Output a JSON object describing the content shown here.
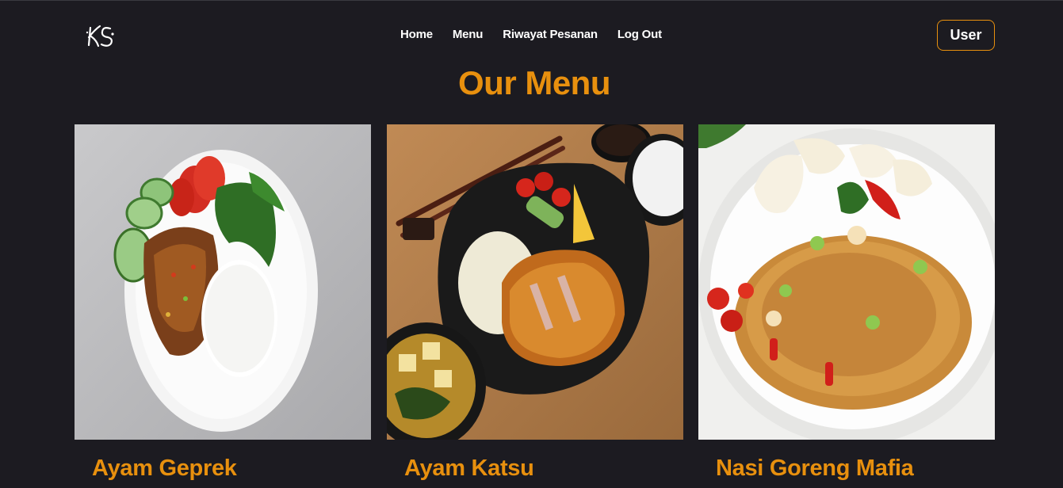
{
  "brand": {
    "logo_text": "KS",
    "logo_icon": "ks-logo-icon"
  },
  "nav": {
    "links": [
      {
        "label": "Home"
      },
      {
        "label": "Menu"
      },
      {
        "label": "Riwayat Pesanan"
      },
      {
        "label": "Log Out"
      }
    ],
    "user_button": "User"
  },
  "page": {
    "title": "Our Menu"
  },
  "menu": {
    "items": [
      {
        "name": "Ayam Geprek"
      },
      {
        "name": "Ayam Katsu"
      },
      {
        "name": "Nasi Goreng Mafia"
      }
    ]
  },
  "colors": {
    "background": "#1c1b21",
    "accent": "#e8900e",
    "text": "#ffffff"
  }
}
